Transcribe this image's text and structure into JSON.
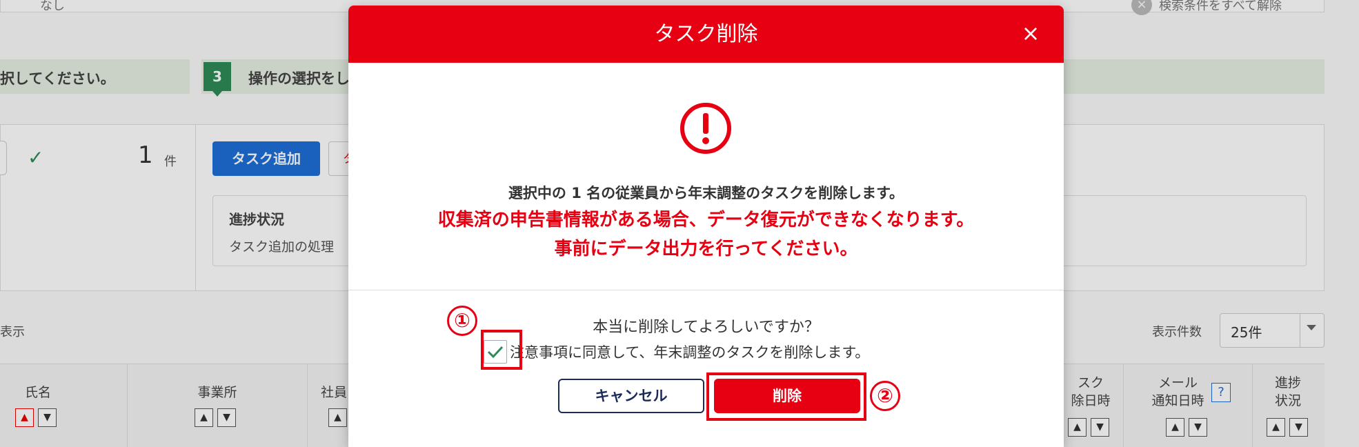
{
  "background": {
    "top_text": "なし",
    "clear_filters": "検索条件をすべて解除",
    "step_prev_text": "択してください。",
    "step3_number": "3",
    "step3_text": "操作の選択をし",
    "count_value": "1",
    "count_unit": "件",
    "add_task_button": "タスク追加",
    "add_task_secondary": "タ",
    "progress_title": "進捗状況",
    "progress_text": "タスク追加の処理",
    "display_label": "表示",
    "per_page_label": "表示件数",
    "per_page_value": "25件",
    "columns": [
      {
        "label": "氏名"
      },
      {
        "label": "事業所"
      },
      {
        "label": "社員"
      },
      {
        "label": "スク\n除日時"
      },
      {
        "label": "メール\n通知日時"
      },
      {
        "label": "進捗\n状況"
      }
    ],
    "help_icon": "?"
  },
  "modal": {
    "title": "タスク削除",
    "close_icon": "×",
    "message_main": "選択中の 1 名の従業員から年末調整のタスクを削除します。",
    "warning_line1": "収集済の申告書情報がある場合、データ復元ができなくなります。",
    "warning_line2": "事前にデータ出力を行ってください。",
    "confirm_question": "本当に削除してよろしいですか？",
    "agree_label": "注意事項に同意して、年末調整のタスクを削除します。",
    "agree_checked": true,
    "cancel_button": "キャンセル",
    "delete_button": "削除"
  },
  "annotations": {
    "step1": "①",
    "step2": "②"
  },
  "colors": {
    "brand_red": "#e60012",
    "cancel_navy": "#1a2a5a",
    "check_green": "#2e8b57"
  }
}
